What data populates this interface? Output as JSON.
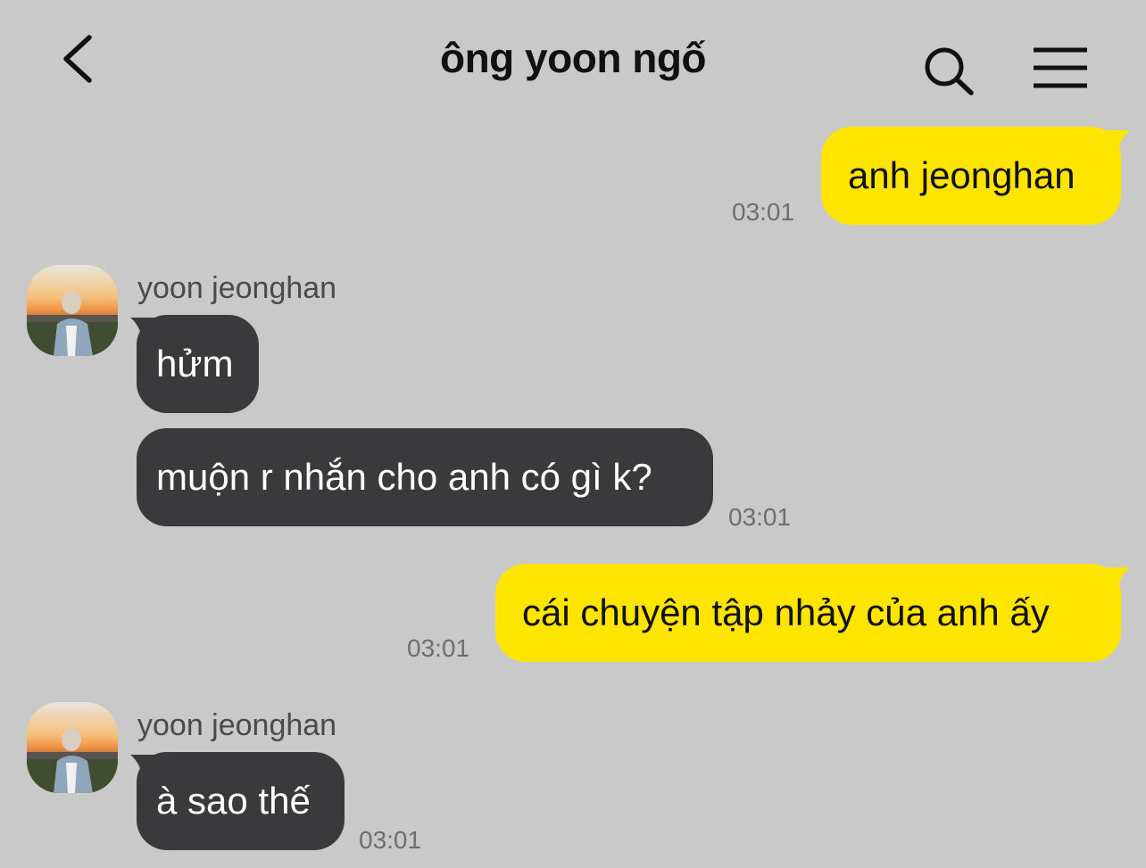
{
  "header": {
    "title": "ông yoon ngố",
    "back_icon": "chevron-left-icon",
    "search_icon": "search-icon",
    "menu_icon": "hamburger-menu-icon"
  },
  "colors": {
    "background": "#c9c9c9",
    "outgoing_bubble": "#fee500",
    "incoming_bubble": "#3a3a3c",
    "timestamp": "#6e6e6e"
  },
  "messages": [
    {
      "direction": "outgoing",
      "text": "anh jeonghan",
      "time": "03:01"
    },
    {
      "direction": "incoming",
      "sender": "yoon jeonghan",
      "text": "hửm"
    },
    {
      "direction": "incoming",
      "text": "muộn r nhắn cho anh có gì k?",
      "time": "03:01"
    },
    {
      "direction": "outgoing",
      "text": "cái chuyện tập nhảy của anh ấy",
      "time": "03:01"
    },
    {
      "direction": "incoming",
      "sender": "yoon jeonghan",
      "text": "à sao thế",
      "time": "03:01"
    }
  ]
}
